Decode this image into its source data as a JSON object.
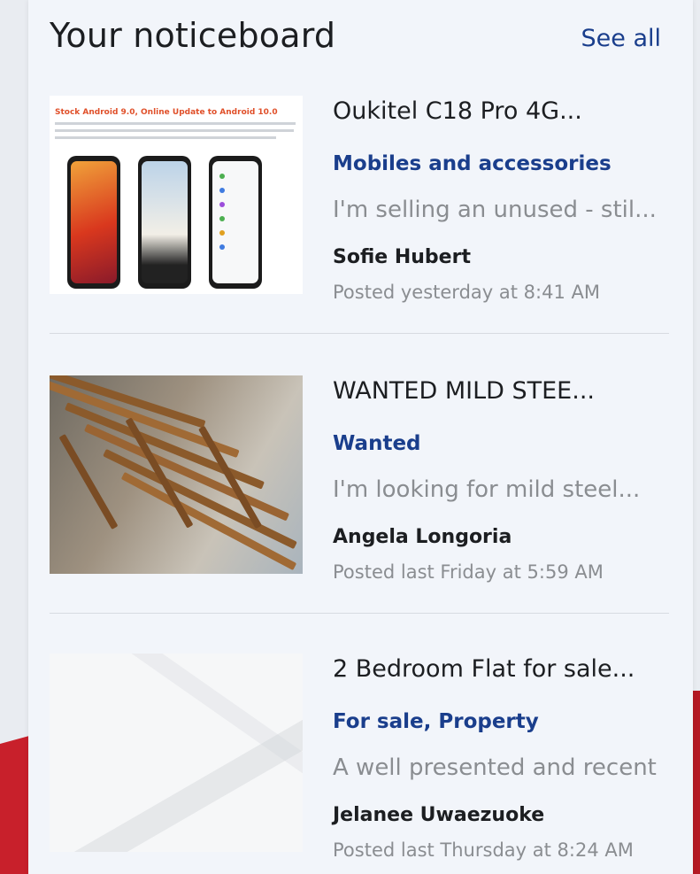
{
  "header": {
    "title": "Your noticeboard",
    "see_all": "See all"
  },
  "items": [
    {
      "title": "Oukitel C18 Pro 4G...",
      "category": "Mobiles and accessories",
      "description": "I'm selling an unused - stil...",
      "author": "Sofie Hubert",
      "posted": "Posted yesterday at 8:41 AM",
      "thumb_caption": "Stock Android 9.0, Online Update to Android 10.0"
    },
    {
      "title": "WANTED MILD STEE...",
      "category": "Wanted",
      "description": "I'm looking for mild steel...",
      "author": "Angela Longoria",
      "posted": "Posted last Friday at 5:59 AM"
    },
    {
      "title": "2 Bedroom Flat for sale...",
      "category": "For sale, Property",
      "description": "A well presented and recent",
      "author": "Jelanee Uwaezuoke",
      "posted": "Posted last Thursday at 8:24 AM"
    }
  ],
  "colors": {
    "link": "#1a3e8c",
    "muted": "#8a8d91",
    "accent_red": "#c8202b"
  }
}
